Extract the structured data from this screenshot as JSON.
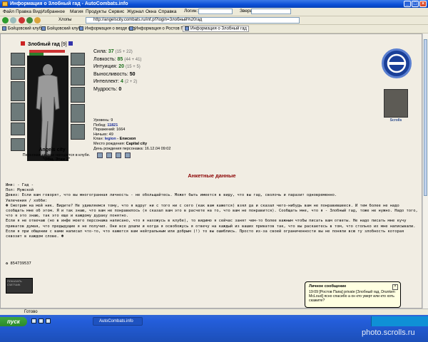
{
  "window": {
    "title": "Информация о Злобный гад - AutoCombats.info"
  },
  "menu": {
    "items": [
      "Файл",
      "Правка",
      "Вид",
      "Избранное",
      "Магия",
      "Продукты",
      "Сервис",
      "Журнал",
      "Окна",
      "Справка"
    ],
    "login_label": "Логин:",
    "beasts_label": "Звери:"
  },
  "toolbar": {
    "go_label": "Хлопы",
    "address": "http://angelscity.combats.ru/inf.pl?login=Злобный%20гад"
  },
  "bookmarks": {
    "items": [
      "Бойцовский клуб",
      "Бойцовский клуб",
      "Информация о везде код",
      "Информация о Ростов Папа",
      "Информация о Злобный гад"
    ]
  },
  "character": {
    "name": "Злобный гад",
    "level": "[9]",
    "location": "Angels city",
    "location_note": "Персонаж сейчас находится в клубе.",
    "room": "\"Общ. Этаж 2\""
  },
  "stats": [
    {
      "label": "Сила:",
      "value": "37",
      "bonus": "(15 + 22)"
    },
    {
      "label": "Ловкость:",
      "value": "85",
      "bonus": "(44 + 41)"
    },
    {
      "label": "Интуиция:",
      "value": "20",
      "bonus": "(15 + 5)"
    },
    {
      "label": "Выносливость:",
      "value": "50",
      "bonus": ""
    },
    {
      "label": "Интеллект:",
      "value": "4",
      "bonus": "(2 + 2)"
    },
    {
      "label": "Мудрость:",
      "value": "0",
      "bonus": ""
    }
  ],
  "info": {
    "level": "Уровень: 9",
    "wins_label": "Побед:",
    "wins": "11821",
    "losses": "Поражений: 1664",
    "draws": "Ничьих: 49",
    "clan_label": "Клан:",
    "clan": "legion",
    "clan_suffix": " - Епископ",
    "birthplace_label": "Место рождения:",
    "birthplace": "Capital city",
    "birthday": "День рождения персонажа: 16.12.04 09:02"
  },
  "scroll_label": "Scrolls",
  "section_title": "Анкетные данные",
  "bio": {
    "name": "Имя: - Гад -",
    "gender": "Пол: Мужской",
    "motto": "Девиз: Если вам говорят, что вы многогранная личность - не обольщайтесь. Может быть имеется в виду, что вы гад, сволочь и паразит одновременно.",
    "hobbies_title": "Увлечения / хобби:",
    "hobbies_text": "☻ Смотрим на мой ник. Видите? Не удивляемся тому, что я вдруг ни с того ни с сего (как вам кажется) взял да и сказал чего-нибудь вам не понравившееся. И тем более не надо сообщать мне об этом. Я и так знаю, что вам не понравилось (я сказал вам это в расчете на то, что вам не понравится). Сообщать мне, что я - Злобный гад, тоже не нужно. Надо того, что я это знаю, так это еще и каждому дураку понятно.",
    "p2": "Если я не отвечаю (но в инфе моего персонажа написано, что я нахожусь в клубе), то видимо я сейчас занят чем-то более важным чтобы писать вам ответы. Не надо писать мне кучу приватов думая, что предыдущие я не получил. Они все дошли и когда я освобожусь я отвечу на каждый из ваших приватов так, что вы раскаетесь в том, что столько их мне написывали.",
    "p3": "Если я при общении с вами написал что-то, что кажется вам нейтральным или добрым (!) то вы ошиблись. Просто из-за своей ограниченности вы не поняли всю ту злобность которая сквозит в каждом слове. ☻"
  },
  "icq": "✿ 854739537",
  "counter_text": "ПОКАЗАТЬ СЧЕТЧИК",
  "statusbar": {
    "text": "Готово"
  },
  "taskbar": {
    "start": "пуск",
    "item": "AutoCombats.info"
  },
  "balloon": {
    "title": "Личное сообщение",
    "text": "19:09 [Ростов Папа] private [Злобный гад, Drunken McLoud] ясно спасибо а он кто уверт или кто хоть скажите?"
  },
  "watermark": "photo.scrolls.ru"
}
